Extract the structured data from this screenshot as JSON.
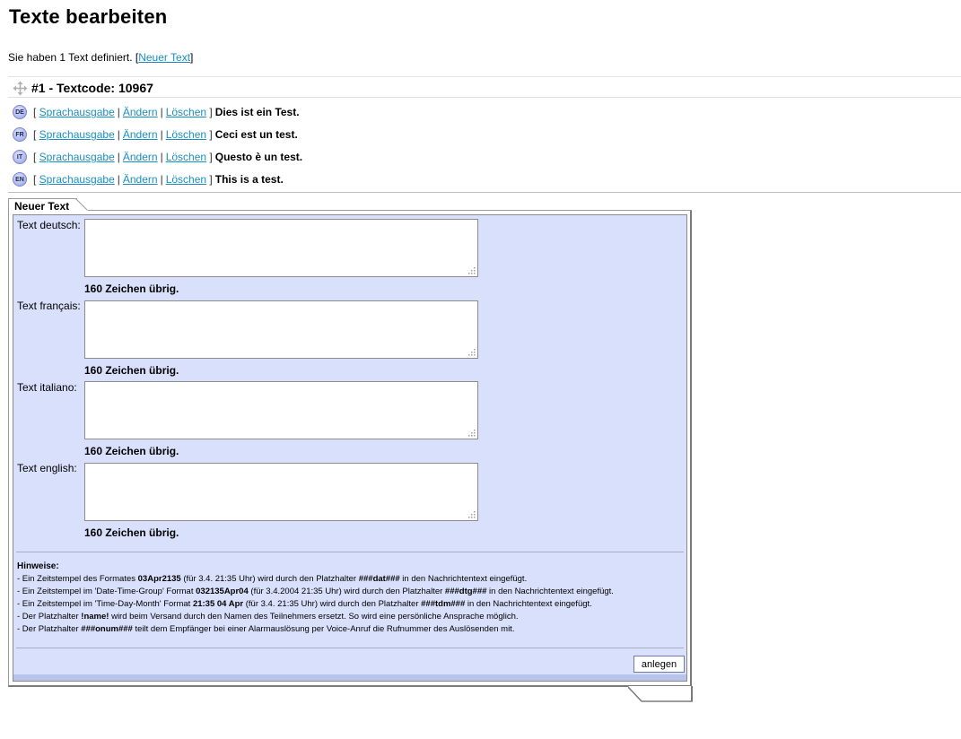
{
  "page": {
    "title": "Texte bearbeiten",
    "summary_prefix": "Sie haben 1 Text definiert. [",
    "new_text_link": "Neuer Text",
    "summary_suffix": "]"
  },
  "entry": {
    "heading": "#1 - Textcode: 10967",
    "actions": {
      "speech": "Sprachausgabe",
      "edit": "Ändern",
      "delete": "Löschen"
    },
    "languages": [
      {
        "code": "DE",
        "text": "Dies ist ein Test."
      },
      {
        "code": "FR",
        "text": "Ceci est un test."
      },
      {
        "code": "IT",
        "text": "Questo è un test."
      },
      {
        "code": "EN",
        "text": "This is a test."
      }
    ]
  },
  "form": {
    "tab_label": "Neuer Text",
    "fields": [
      {
        "label": "Text deutsch:",
        "value": "",
        "remaining": "160 Zeichen übrig."
      },
      {
        "label": "Text français:",
        "value": "",
        "remaining": "160 Zeichen übrig."
      },
      {
        "label": "Text italiano:",
        "value": "",
        "remaining": "160 Zeichen übrig."
      },
      {
        "label": "Text english:",
        "value": "",
        "remaining": "160 Zeichen übrig."
      }
    ],
    "hints_title": "Hinweise:",
    "hints": [
      {
        "parts": [
          "- Ein Zeitstempel des Formates ",
          "03Apr2135",
          " (für 3.4. 21:35 Uhr) wird durch den Platzhalter ",
          "###dat###",
          " in den Nachrichtentext eingefügt."
        ]
      },
      {
        "parts": [
          "- Ein Zeitstempel im 'Date-Time-Group' Format ",
          "032135Apr04",
          " (für 3.4.2004 21:35 Uhr) wird durch den Platzhalter ",
          "###dtg###",
          " in den Nachrichtentext eingefügt."
        ]
      },
      {
        "parts": [
          "- Ein Zeitstempel im 'Time-Day-Month' Format ",
          "21:35 04 Apr",
          " (für 3.4. 21:35 Uhr) wird durch den Platzhalter ",
          "###tdm###",
          " in den Nachrichtentext eingefügt."
        ]
      },
      {
        "parts": [
          "- Der Platzhalter ",
          "!name!",
          " wird beim Versand durch den Namen des Teilnehmers ersetzt. So wird eine persönliche Ansprache möglich.",
          "",
          ""
        ]
      },
      {
        "parts": [
          "- Der Platzhalter ",
          "###onum###",
          " teilt dem Empfänger bei einer Alarmauslösung per Voice-Anruf die Rufnummer des Auslösenden mit.",
          "",
          ""
        ]
      }
    ],
    "submit_label": "anlegen"
  },
  "colors": {
    "link": "#1a8fbf",
    "panel_bg": "#d9e0fb",
    "badge": "#a9b4ee"
  },
  "icons": {
    "move": "move-arrows-icon",
    "language": "language-badge-icon",
    "resize": "resize-grip-icon"
  }
}
